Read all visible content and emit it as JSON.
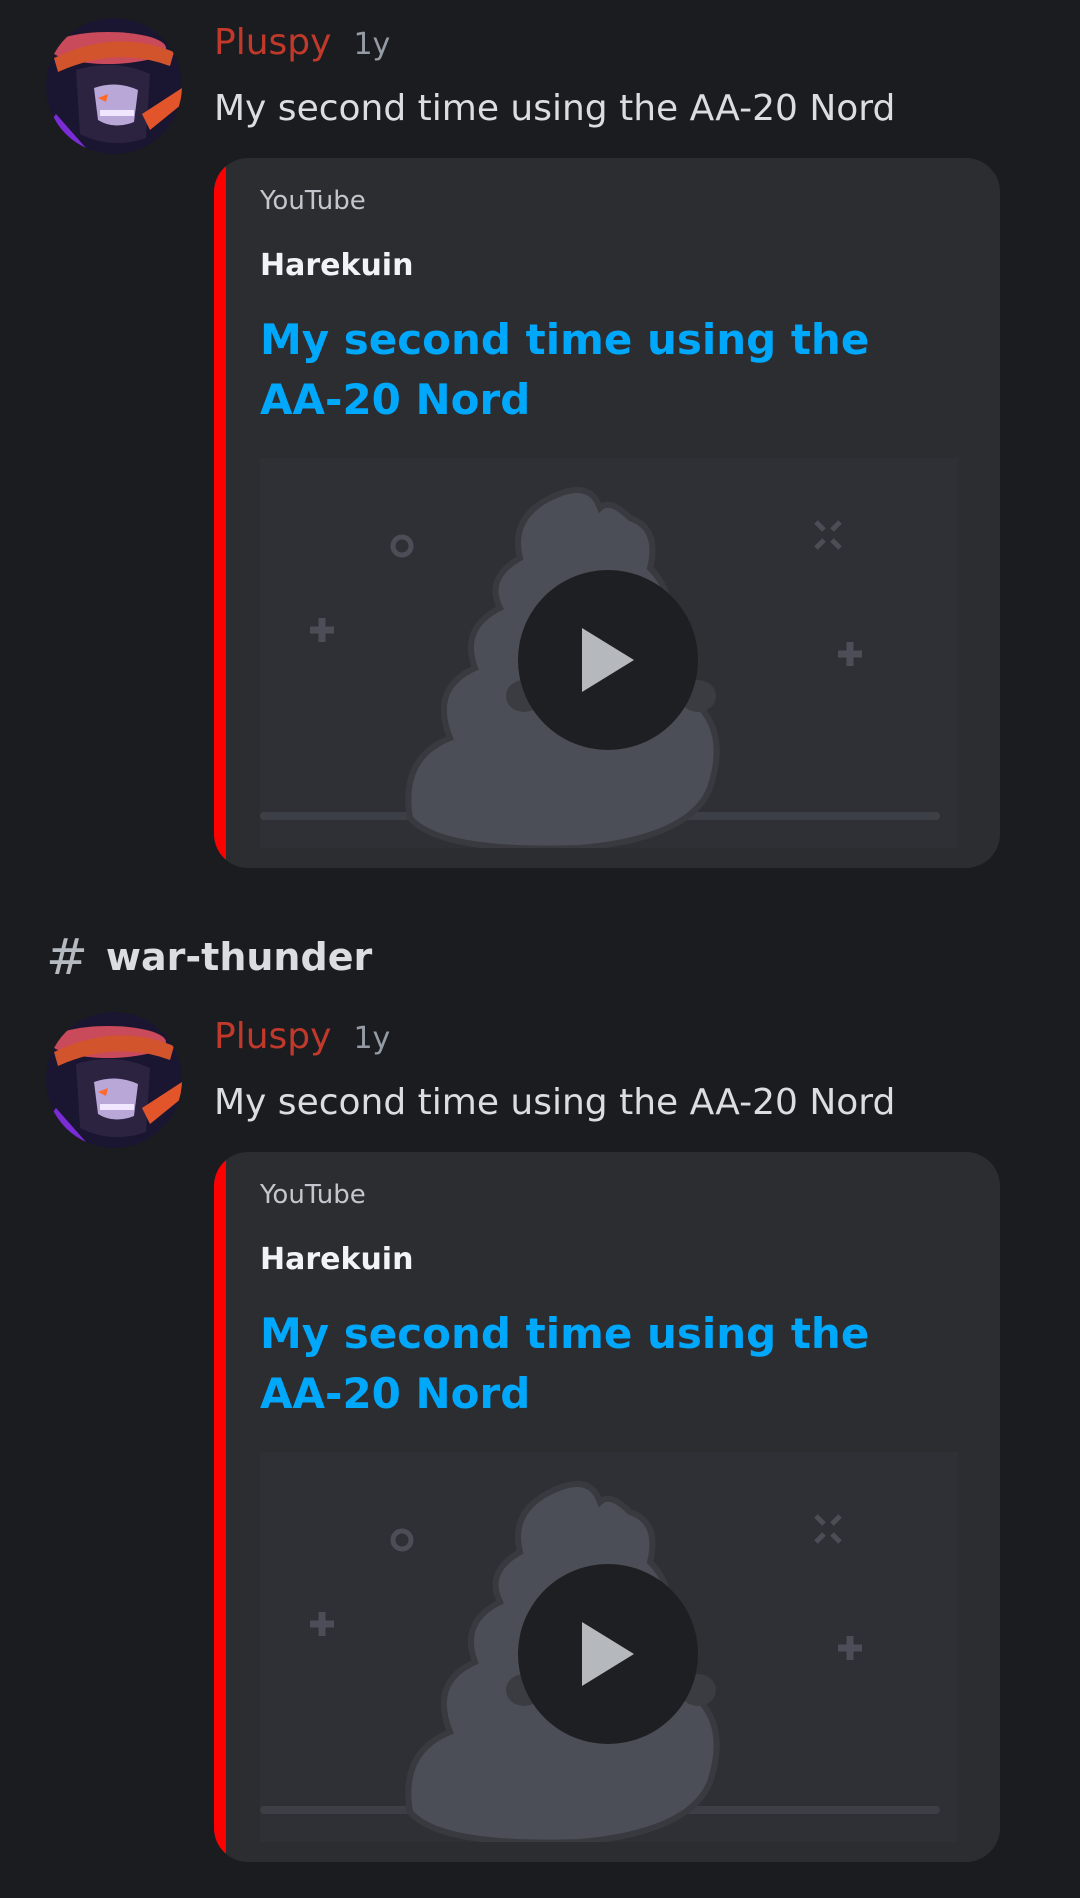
{
  "messages": [
    {
      "author": "Pluspy",
      "timestamp": "1y",
      "text": "My second time using the AA-20 Nord",
      "embed": {
        "provider": "YouTube",
        "author": "Harekuin",
        "title": "My second time using the AA-20 Nord",
        "accent_color": "#ff0000",
        "thumbnail_icon": "play-icon"
      }
    },
    {
      "author": "Pluspy",
      "timestamp": "1y",
      "text": "My second time using the AA-20 Nord",
      "embed": {
        "provider": "YouTube",
        "author": "Harekuin",
        "title": "My second time using the AA-20 Nord",
        "accent_color": "#ff0000",
        "thumbnail_icon": "play-icon"
      }
    }
  ],
  "channel": {
    "icon": "hash-icon",
    "name": "war-thunder"
  },
  "colors": {
    "background": "#1b1c20",
    "author": "#c0392b",
    "link": "#00a8fc",
    "embed_bg": "#2b2d31"
  }
}
